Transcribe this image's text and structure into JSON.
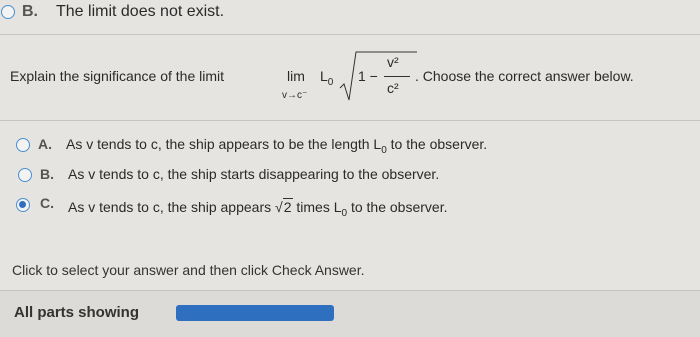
{
  "top_option": {
    "letter": "B.",
    "text": "The limit does not exist."
  },
  "question": {
    "prefix": "Explain the significance of the limit",
    "lim": "lim",
    "lim_sub": "v→c⁻",
    "L": "L",
    "L_sub": "0",
    "one_minus": "1 −",
    "numerator": "v²",
    "denominator": "c²",
    "suffix": ". Choose the correct answer below."
  },
  "options": [
    {
      "letter": "A.",
      "text_before": "As v tends to c, the ship appears to be the length L",
      "sub": "0",
      "text_after": " to the observer."
    },
    {
      "letter": "B.",
      "text": "As v tends to c, the ship starts disappearing to the observer."
    },
    {
      "letter": "C.",
      "text_before": "As v tends to c, the ship appears ",
      "radical": "√",
      "radicand": "2",
      "text_mid": " times L",
      "sub": "0",
      "text_after": " to the observer."
    }
  ],
  "selected_option": "C.",
  "instruction": "Click to select your answer and then click Check Answer.",
  "footer": {
    "label": "All parts showing",
    "progress": 1.0
  },
  "colors": {
    "accent": "#2f6fbf",
    "radio_border": "#4a90d0"
  }
}
